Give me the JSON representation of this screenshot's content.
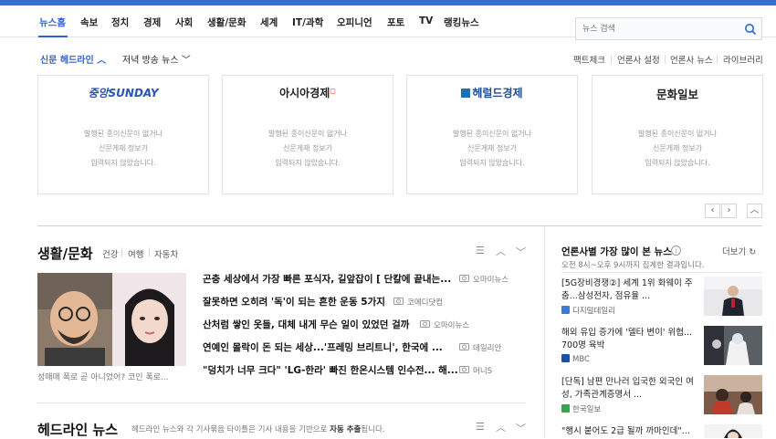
{
  "nav": {
    "items": [
      "뉴스홈",
      "속보",
      "정치",
      "경제",
      "사회",
      "생활/문화",
      "세계",
      "IT/과학",
      "오피니언",
      "포토",
      "TV",
      "랭킹뉴스"
    ],
    "active": "뉴스홈"
  },
  "search": {
    "placeholder": "뉴스 검색"
  },
  "subnav": {
    "left": [
      "신문 헤드라인",
      "저녁 방송 뉴스"
    ],
    "right": [
      "팩트체크",
      "언론사 설정",
      "언론사 뉴스",
      "라이브러리"
    ]
  },
  "papers": [
    {
      "name": "중앙SUNDAY",
      "msg": [
        "발행된 종이신문이 없거나",
        "신문게재 정보가",
        "입력되지 않았습니다."
      ]
    },
    {
      "name": "아시아경제",
      "msg": [
        "발행된 종이신문이 없거나",
        "신문게재 정보가",
        "입력되지 않았습니다."
      ]
    },
    {
      "name": "헤럴드경제",
      "msg": [
        "발행된 종이신문이 없거나",
        "신문게재 정보가",
        "입력되지 않았습니다."
      ]
    },
    {
      "name": "문화일보",
      "msg": [
        "발행된 종이신문이 없거나",
        "신문게재 정보가",
        "입력되지 않았습니다."
      ]
    }
  ],
  "culture": {
    "title": "생활/문화",
    "tags": [
      "건강",
      "여행",
      "자동차"
    ],
    "photo_caption": "성매매 폭로 곧 아니었어? 코인 폭로...",
    "articles": [
      {
        "title": "곤충 세상에서 가장 빠른 포식자, 길앞잡이 [ 단칼에 끝내는...",
        "source": "오마이뉴스"
      },
      {
        "title": "잘못하면 오히려 '독'이 되는 흔한 운동 5가지",
        "source": "코메디닷컴"
      },
      {
        "title": "산처럼 쌓인 옷들, 대체 내게 무슨 일이 있었던 걸까",
        "source": "오마이뉴스"
      },
      {
        "title": "연예인 몰락이 돈 되는 세상...'프레밍 브리트니', 한국에 ...",
        "source": "데일리안"
      },
      {
        "title": "\"덩치가 너무 크다\" 'LG-한라' 빠진 한온시스템 인수전... 해...",
        "source": "머니S"
      }
    ]
  },
  "headline": {
    "title": "헤드라인 뉴스",
    "desc": "헤드라인 뉴스와 각 기사묶음 타이틀은 기사 내용을 기반으로",
    "desc_bold": "자동 추출",
    "desc_end": "됩니다."
  },
  "ranking": {
    "title": "언론사별 가장 많이 본 뉴스",
    "info": "i",
    "more": "더보기",
    "subtitle": "오전 8시~오후 9시까지 집계한 결과입니다.",
    "items": [
      {
        "title": "[5G장비경쟁②] 세계 1위 화웨이 주춤...삼성전자, 점유율 ...",
        "press": "디지털데일리",
        "press_color": "#3a7bd5"
      },
      {
        "title": "해외 유입 증가에 '델타 변이' 위협... 700명 육박",
        "press": "MBC",
        "press_color": "#1f4fa8"
      },
      {
        "title": "[단독] 남편 만나러 입국한 외국인 여성, 가족관계증명서 ...",
        "press": "한국일보",
        "press_color": "#2fa84f"
      },
      {
        "title": "\"행시 붙어도 2급 될까 까마인데\"...",
        "press": "",
        "press_color": "#888888"
      }
    ]
  },
  "icons": {
    "search": "search-icon",
    "camera": "camera-icon",
    "menu": "menu-icon",
    "chevron_up": "chevron-up-icon",
    "chevron_down": "chevron-down-icon",
    "refresh": "refresh-icon"
  },
  "pager": {
    "prev": "‹",
    "next": "›",
    "up": "︿"
  },
  "colors": {
    "accent": "#2d63d6",
    "topbar": "#3b6ed1"
  }
}
